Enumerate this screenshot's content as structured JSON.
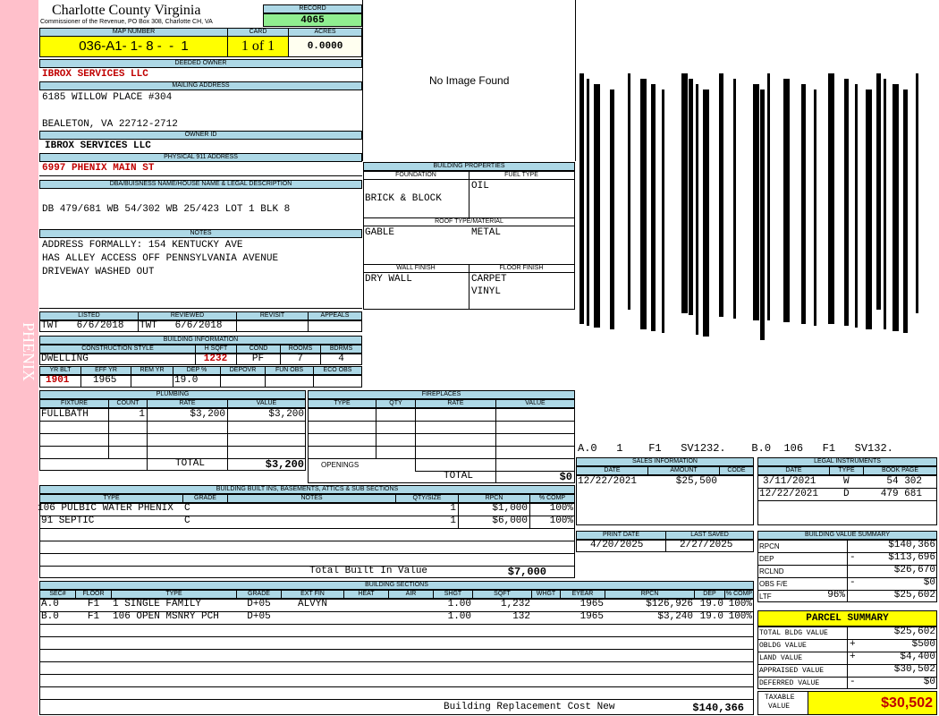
{
  "side_label": "PHENIX",
  "header": {
    "county": "Charlotte County Virginia",
    "commissioner": "Commissioner of the Revenue, PO Box 308, Charlotte CH, VA",
    "record_label": "RECORD",
    "record": "4065",
    "map_number_label": "MAP NUMBER",
    "map_number": "036-A1- 1- 8 -  -  1",
    "card_label": "CARD",
    "card": "1 of 1",
    "acres_label": "ACRES",
    "acres": "0.0000"
  },
  "owner": {
    "deeded_owner_label": "DEEDED OWNER",
    "deeded_owner": "IBROX SERVICES LLC",
    "mailing_address_label": "MAILING ADDRESS",
    "mailing_line1": "6185 WILLOW PLACE #304",
    "mailing_line2": "BEALETON, VA 22712-2712",
    "owner_id_label": "OWNER ID",
    "owner_id": "IBROX SERVICES LLC",
    "physical_label": "PHYSICAL 911 ADDRESS",
    "physical_address": "6997 PHENIX MAIN ST"
  },
  "legal": {
    "label": "DBA/BUISNESS NAME/HOUSE NAME & LEGAL DESCRIPTION",
    "text": "DB 479/681 WB 54/302 WB 25/423 LOT 1 BLK 8"
  },
  "notes": {
    "label": "NOTES",
    "lines": [
      "ADDRESS FORMALLY: 154 KENTUCKY AVE",
      "HAS ALLEY ACCESS OFF PENNSYLVANIA AVENUE",
      "DRIVEWAY WASHED OUT"
    ]
  },
  "image": {
    "text": "No Image Found"
  },
  "barcode": {
    "text": "A.0   1    F1   SV1232.    B.0  106   F1   SV132."
  },
  "building_properties": {
    "label": "BUILDING PROPERTIES",
    "foundation_label": "FOUNDATION",
    "foundation": "BRICK & BLOCK",
    "fuel_label": "FUEL TYPE",
    "fuel": "OIL",
    "roof_label": "ROOF TYPE/MATERIAL",
    "roof_type": "GABLE",
    "roof_material": "METAL",
    "wall_label": "WALL FINISH",
    "wall": "DRY WALL",
    "floor_label": "FLOOR FINISH",
    "floor1": "CARPET",
    "floor2": "VINYL"
  },
  "review": {
    "listed_label": "LISTED",
    "reviewed_label": "REVIEWED",
    "revisit_label": "REVISIT",
    "appeals_label": "APPEALS",
    "listed": "TWT   6/6/2018",
    "reviewed": "TWT   6/6/2018"
  },
  "building_info": {
    "label": "BUILDING INFORMATION",
    "style_label": "CONSTRUCTION STYLE",
    "style": "DWELLING",
    "hsqft_label": "H SQFT",
    "hsqft": "1232",
    "cond_label": "COND",
    "cond": "PF",
    "rooms_label": "ROOMS",
    "rooms": "7",
    "bdrms_label": "BDRMS",
    "bdrms": "4",
    "yrblt_label": "YR BLT",
    "yrblt": "1901",
    "effyr_label": "EFF YR",
    "effyr": "1965",
    "remyr_label": "REM YR",
    "dep_label": "DEP %",
    "dep": "19.0",
    "depovr_label": "DEPOVR",
    "funobs_label": "FUN OBS",
    "ecoobs_label": "ECO OBS"
  },
  "plumbing": {
    "label": "PLUMBING",
    "cols": [
      "FIXTURE",
      "COUNT",
      "RATE",
      "VALUE"
    ],
    "rows": [
      {
        "fixture": "FULLBATH",
        "count": "1",
        "rate": "$3,200",
        "value": "$3,200"
      }
    ],
    "total_label": "TOTAL",
    "total": "$3,200"
  },
  "fireplaces": {
    "label": "FIREPLACES",
    "cols": [
      "TYPE",
      "QTY",
      "RATE",
      "VALUE"
    ],
    "openings_label": "OPENINGS",
    "total_label": "TOTAL",
    "total": "$0"
  },
  "builtins": {
    "label": "BUILDING BUILT INS, BASEMENTS, ATTICS & SUB SECTIONS",
    "cols": [
      "TYPE",
      "GRADE",
      "NOTES",
      "QTY/SIZE",
      "RPCN",
      "% COMP"
    ],
    "rows": [
      {
        "type": "106 PULBIC WATER PHENIX",
        "grade": "C",
        "qty": "1",
        "rpcn": "$1,000",
        "comp": "100%"
      },
      {
        "type": "91 SEPTIC",
        "grade": "C",
        "qty": "1",
        "rpcn": "$6,000",
        "comp": "100%"
      }
    ],
    "total_label": "Total Built In Value",
    "total": "$7,000"
  },
  "sales": {
    "label": "SALES INFORMATION",
    "cols": [
      "DATE",
      "AMOUNT",
      "CODE"
    ],
    "rows": [
      {
        "date": "12/22/2021",
        "amount": "$25,500",
        "code": ""
      }
    ]
  },
  "legal_instruments": {
    "label": "LEGAL INSTRUMENTS",
    "cols": [
      "DATE",
      "TYPE",
      "BOOK PAGE"
    ],
    "rows": [
      {
        "date": "3/11/2021",
        "type": "W",
        "book": "54 302"
      },
      {
        "date": "12/22/2021",
        "type": "D",
        "book": "479 681"
      }
    ]
  },
  "print": {
    "print_label": "PRINT DATE",
    "print_date": "4/20/2025",
    "saved_label": "LAST SAVED",
    "saved_date": "2/27/2025"
  },
  "value_summary": {
    "label": "BUILDING VALUE SUMMARY",
    "rows": [
      {
        "name": "RPCN",
        "sign": "",
        "extra": "",
        "value": "$140,366"
      },
      {
        "name": "DEP",
        "sign": "-",
        "extra": "",
        "value": "$113,696"
      },
      {
        "name": "RCLND",
        "sign": "",
        "extra": "",
        "value": "$26,670"
      },
      {
        "name": "OBS F/E",
        "sign": "-",
        "extra": "",
        "value": "$0"
      },
      {
        "name": "LTF",
        "sign": "",
        "extra": "96%",
        "value": "$25,602"
      }
    ]
  },
  "building_sections": {
    "label": "BUILDING SECTIONS",
    "cols": [
      "SEC#",
      "FLOOR",
      "TYPE",
      "GRADE",
      "EXT FIN",
      "HEAT",
      "AIR",
      "SHGT",
      "SQFT",
      "WHGT",
      "EYEAR",
      "RPCN",
      "DEP",
      "% COMP"
    ],
    "rows": [
      {
        "sec": "A.0",
        "floor": "F1",
        "type": "1 SINGLE FAMILY",
        "grade": "D+05",
        "ext": "ALVYN",
        "heat": "",
        "air": "",
        "shgt": "1.00",
        "sqft": "1,232",
        "whgt": "",
        "eyear": "1965",
        "rpcn": "$126,926",
        "dep": "19.0",
        "comp": "100%"
      },
      {
        "sec": "B.0",
        "floor": "F1",
        "type": "106 OPEN MSNRY PCH",
        "grade": "D+05",
        "ext": "",
        "heat": "",
        "air": "",
        "shgt": "1.00",
        "sqft": "132",
        "whgt": "",
        "eyear": "1965",
        "rpcn": "$3,240",
        "dep": "19.0",
        "comp": "100%"
      }
    ],
    "total_label": "Building Replacement Cost New",
    "total": "$140,366"
  },
  "parcel_summary": {
    "label": "PARCEL SUMMARY",
    "rows": [
      {
        "name": "TOTAL BLDG VALUE",
        "sign": "",
        "value": "$25,602"
      },
      {
        "name": "OBLDG VALUE",
        "sign": "+",
        "value": "$500"
      },
      {
        "name": "LAND VALUE",
        "sign": "+",
        "value": "$4,400"
      },
      {
        "name": "APPRAISED VALUE",
        "sign": "",
        "value": "$30,502"
      },
      {
        "name": "DEFERRED VALUE",
        "sign": "-",
        "value": "$0"
      }
    ],
    "taxable_label1": "TAXABLE",
    "taxable_label2": "VALUE",
    "taxable": "$30,502"
  },
  "colors": {
    "header_blue": "#add8e6",
    "highlight_yellow": "#ffff00",
    "record_green": "#90ee90",
    "side_pink": "#ffc0cb",
    "value_red": "#c00000"
  }
}
